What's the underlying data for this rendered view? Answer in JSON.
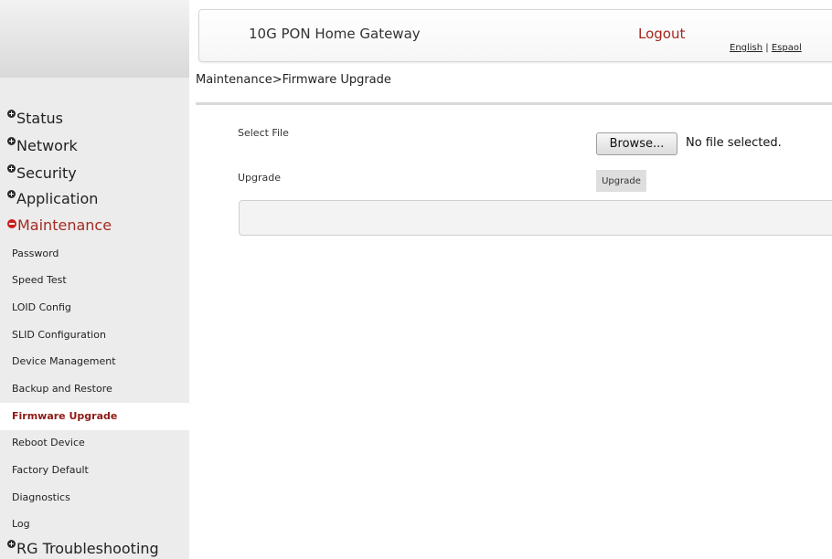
{
  "header": {
    "title": "10G PON Home Gateway",
    "logout_label": "Logout",
    "lang_english": "English",
    "lang_separator": " | ",
    "lang_espanol": "Espaol"
  },
  "breadcrumb": "Maintenance>Firmware Upgrade",
  "sidebar": {
    "top_items": [
      {
        "label": "Status",
        "icon": "plus-icon"
      },
      {
        "label": "Network",
        "icon": "plus-icon"
      },
      {
        "label": "Security",
        "icon": "plus-icon"
      },
      {
        "label": "Application",
        "icon": "plus-icon"
      },
      {
        "label": "Maintenance",
        "icon": "minus-icon"
      }
    ],
    "maintenance_items": [
      "Password",
      "Speed Test",
      "LOID Config",
      "SLID Configuration",
      "Device Management",
      "Backup and Restore",
      "Firmware Upgrade",
      "Reboot Device",
      "Factory Default",
      "Diagnostics",
      "Log"
    ],
    "bottom_item": {
      "label": "RG Troubleshooting",
      "icon": "plus-icon"
    },
    "selected_item": "Firmware Upgrade"
  },
  "form": {
    "select_file_label": "Select File",
    "browse_label": "Browse...",
    "file_status": "No file selected.",
    "upgrade_label": "Upgrade",
    "upgrade_button_label": "Upgrade"
  },
  "colors": {
    "accent_red": "#a3271e",
    "selected_text": "#8e1b16",
    "sidebar_bg": "#ececec"
  }
}
